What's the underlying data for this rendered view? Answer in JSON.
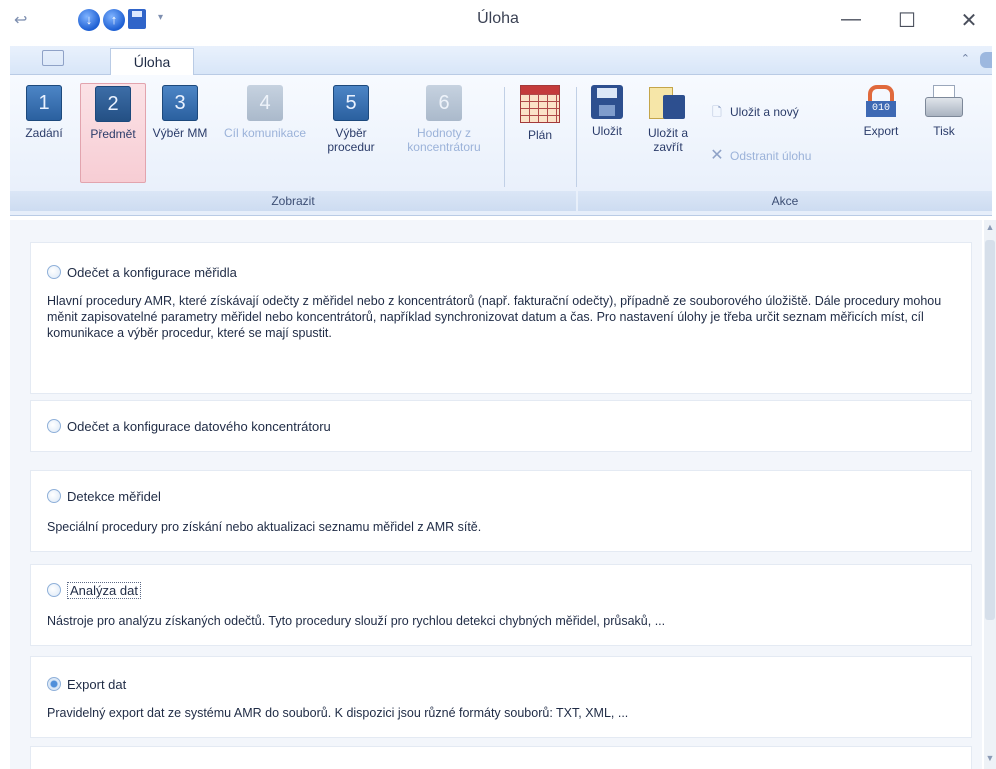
{
  "window": {
    "title": "Úloha",
    "minimize": "—",
    "maximize": "☐",
    "close": "✕",
    "qat_back": "↩",
    "qat_down": "↓",
    "qat_up": "↑",
    "qat_dropdown": "▾"
  },
  "tabs": {
    "active": "Úloha",
    "minimize_ribbon": "⌃"
  },
  "ribbon": {
    "buttons": [
      {
        "num": "1",
        "label": "Zadání"
      },
      {
        "num": "2",
        "label": "Předmět"
      },
      {
        "num": "3",
        "label": "Výběr MM"
      },
      {
        "num": "4",
        "label": "Cíl komunikace"
      },
      {
        "num": "5",
        "label": "Výběr procedur"
      },
      {
        "num": "6",
        "label": "Hodnoty z koncentrátoru"
      }
    ],
    "plan": "Plán",
    "save": "Uložit",
    "save_close": "Uložit a zavřít",
    "save_new": "Uložit a nový",
    "delete_task": "Odstranit úlohu",
    "export": "Export",
    "print": "Tisk",
    "group_view": "Zobrazit",
    "group_actions": "Akce"
  },
  "options": [
    {
      "title": "Odečet a konfigurace měřidla",
      "desc": "Hlavní procedury AMR, které získávají odečty z měřidel nebo z koncentrátorů (např. fakturační odečty), případně ze souborového úložiště. Dále procedury mohou měnit zapisovatelné parametry měřidel nebo koncentrátorů, například synchronizovat datum a čas. Pro nastavení úlohy je třeba určit seznam měřicích míst, cíl komunikace a výběr procedur, které se mají spustit."
    },
    {
      "title": "Odečet a konfigurace datového koncentrátoru",
      "desc": ""
    },
    {
      "title": "Detekce měřidel",
      "desc": "Speciální procedury pro získání nebo aktualizaci seznamu měřidel z AMR sítě."
    },
    {
      "title": "Analýza dat",
      "desc": "Nástroje pro analýzu získaných odečtů. Tyto procedury slouží pro rychlou detekci chybných měřidel, průsaků, ..."
    },
    {
      "title": "Export dat",
      "desc": "Pravidelný export dat ze systému AMR do souborů. K dispozici jsou různé formáty souborů: TXT, XML, ..."
    }
  ],
  "selected_option": "Export dat",
  "colors": {
    "accent": "#2a5f9e",
    "selected_ribbon": "#f7cdd4",
    "disabled_text": "#9bb2d9"
  }
}
